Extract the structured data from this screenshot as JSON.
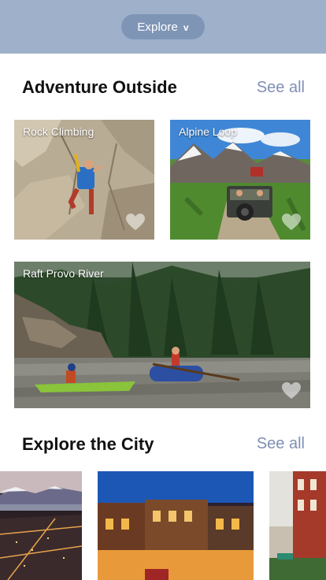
{
  "header": {
    "explore_label": "Explore",
    "chevron_glyph": "v"
  },
  "sections": [
    {
      "title": "Adventure Outside",
      "see_all": "See all",
      "cards": [
        {
          "label": "Rock Climbing",
          "favorite_icon": "heart-icon"
        },
        {
          "label": "Alpine Loop",
          "favorite_icon": "heart-icon"
        },
        {
          "label": "Raft Provo River",
          "favorite_icon": "heart-icon"
        }
      ]
    },
    {
      "title": "Explore the City",
      "see_all": "See all"
    }
  ],
  "colors": {
    "header_bg": "#9fb0ca",
    "pill_bg": "#7f95b6",
    "see_all": "#7f8fb4"
  }
}
